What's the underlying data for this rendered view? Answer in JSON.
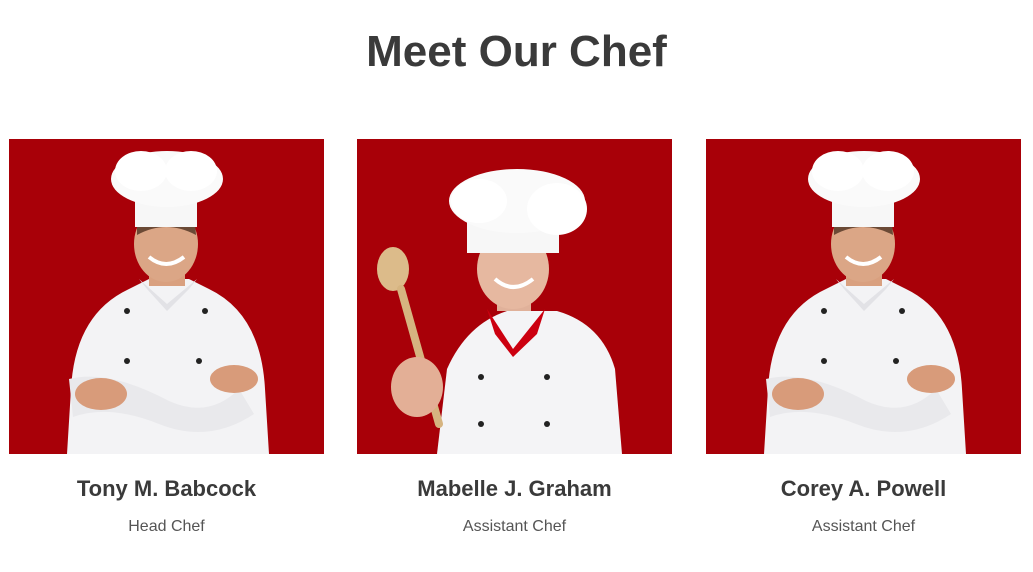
{
  "section": {
    "title": "Meet Our Chef"
  },
  "colors": {
    "photo_background": "#a80008",
    "uniform": "#f4f4f6",
    "text_dark": "#3a3a3a",
    "text_muted": "#555555"
  },
  "chefs": [
    {
      "name": "Tony M. Babcock",
      "role": "Head Chef",
      "photo": "male-chef-arms-crossed-photo"
    },
    {
      "name": "Mabelle J. Graham",
      "role": "Assistant Chef",
      "photo": "female-chef-wooden-spoon-photo"
    },
    {
      "name": "Corey A. Powell",
      "role": "Assistant Chef",
      "photo": "male-chef-arms-crossed-photo"
    }
  ]
}
